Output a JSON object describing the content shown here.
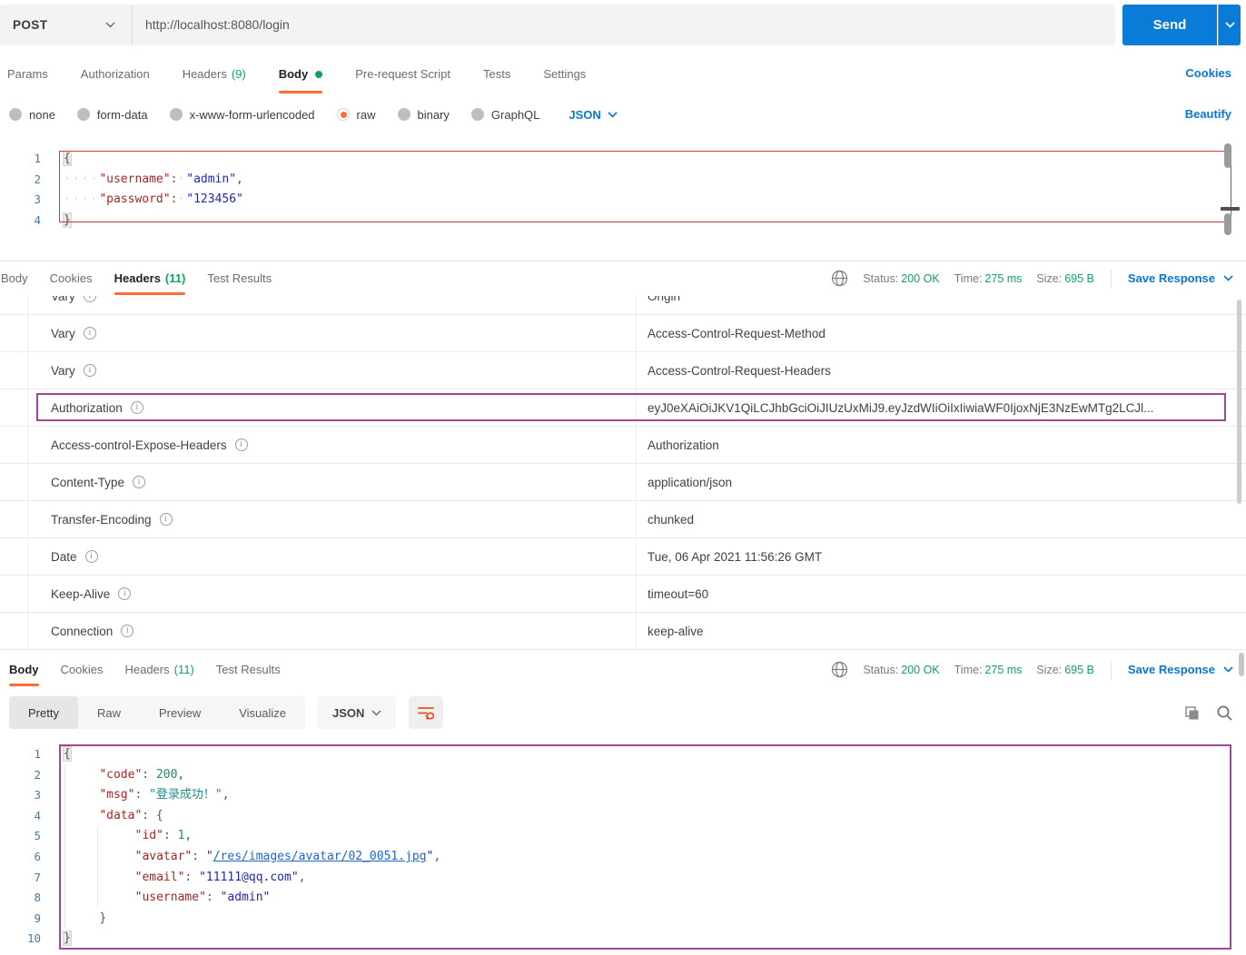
{
  "request": {
    "method": "POST",
    "url": "http://localhost:8080/login",
    "send_label": "Send",
    "cookies_link": "Cookies",
    "beautify_link": "Beautify",
    "raw_language": "JSON",
    "tabs": [
      {
        "label": "Params"
      },
      {
        "label": "Authorization"
      },
      {
        "label": "Headers",
        "count": "(9)"
      },
      {
        "label": "Body",
        "active": true,
        "dot": true
      },
      {
        "label": "Pre-request Script"
      },
      {
        "label": "Tests"
      },
      {
        "label": "Settings"
      }
    ],
    "body_modes": [
      {
        "label": "none"
      },
      {
        "label": "form-data"
      },
      {
        "label": "x-www-form-urlencoded"
      },
      {
        "label": "raw",
        "selected": true
      },
      {
        "label": "binary"
      },
      {
        "label": "GraphQL"
      }
    ],
    "body_lines": [
      {
        "n": "1",
        "tokens": [
          [
            "br",
            "{"
          ]
        ]
      },
      {
        "n": "2",
        "tokens": [
          [
            "ws",
            "····"
          ],
          [
            "key",
            "\"username\""
          ],
          [
            "pun",
            ":"
          ],
          [
            "ws",
            "·"
          ],
          [
            "str",
            "\"admin\""
          ],
          [
            "pun",
            ","
          ]
        ]
      },
      {
        "n": "3",
        "tokens": [
          [
            "ws",
            "····"
          ],
          [
            "key",
            "\"password\""
          ],
          [
            "pun",
            ":"
          ],
          [
            "ws",
            "·"
          ],
          [
            "str",
            "\"123456\""
          ]
        ]
      },
      {
        "n": "4",
        "tokens": [
          [
            "br",
            "}"
          ]
        ]
      }
    ]
  },
  "response_meta": {
    "status_label": "Status:",
    "status_value": "200 OK",
    "time_label": "Time:",
    "time_value": "275 ms",
    "size_label": "Size:",
    "size_value": "695 B",
    "save_label": "Save Response"
  },
  "headers_pane": {
    "tabs": [
      {
        "label": "Body"
      },
      {
        "label": "Cookies"
      },
      {
        "label": "Headers",
        "count": "(11)",
        "active": true
      },
      {
        "label": "Test Results"
      }
    ],
    "info_icon_glyph": "i",
    "rows": [
      {
        "key": "Vary",
        "value": "Origin"
      },
      {
        "key": "Vary",
        "value": "Access-Control-Request-Method"
      },
      {
        "key": "Vary",
        "value": "Access-Control-Request-Headers"
      },
      {
        "key": "Authorization",
        "value": "eyJ0eXAiOiJKV1QiLCJhbGciOiJIUzUxMiJ9.eyJzdWIiOiIxIiwiaWF0IjoxNjE3NzEwMTg2LCJl...",
        "highlighted": true
      },
      {
        "key": "Access-control-Expose-Headers",
        "value": "Authorization"
      },
      {
        "key": "Content-Type",
        "value": "application/json"
      },
      {
        "key": "Transfer-Encoding",
        "value": "chunked"
      },
      {
        "key": "Date",
        "value": "Tue, 06 Apr 2021 11:56:26 GMT"
      },
      {
        "key": "Keep-Alive",
        "value": "timeout=60"
      },
      {
        "key": "Connection",
        "value": "keep-alive"
      }
    ]
  },
  "body_pane": {
    "tabs": [
      {
        "label": "Body",
        "active": true
      },
      {
        "label": "Cookies"
      },
      {
        "label": "Headers",
        "count": "(11)"
      },
      {
        "label": "Test Results"
      }
    ],
    "views": [
      {
        "label": "Pretty",
        "selected": true
      },
      {
        "label": "Raw"
      },
      {
        "label": "Preview"
      },
      {
        "label": "Visualize"
      }
    ],
    "language": "JSON",
    "lines": [
      {
        "n": "1",
        "tokens": [
          [
            "br",
            "{"
          ]
        ]
      },
      {
        "n": "2",
        "tokens": [
          [
            "ws",
            "    "
          ],
          [
            "key",
            "\"code\""
          ],
          [
            "pun",
            ": "
          ],
          [
            "num",
            "200"
          ],
          [
            "pun",
            ","
          ]
        ]
      },
      {
        "n": "3",
        "tokens": [
          [
            "ws",
            "    "
          ],
          [
            "key",
            "\"msg\""
          ],
          [
            "pun",
            ": "
          ],
          [
            "cjk",
            "\"登录成功！\""
          ],
          [
            "pun",
            ","
          ]
        ]
      },
      {
        "n": "4",
        "tokens": [
          [
            "ws",
            "    "
          ],
          [
            "key",
            "\"data\""
          ],
          [
            "pun",
            ": {"
          ]
        ]
      },
      {
        "n": "5",
        "tokens": [
          [
            "ws",
            "        "
          ],
          [
            "key",
            "\"id\""
          ],
          [
            "pun",
            ": "
          ],
          [
            "num",
            "1"
          ],
          [
            "pun",
            ","
          ]
        ]
      },
      {
        "n": "6",
        "tokens": [
          [
            "ws",
            "        "
          ],
          [
            "key",
            "\"avatar\""
          ],
          [
            "pun",
            ": "
          ],
          [
            "str",
            "\""
          ],
          [
            "lnk",
            "/res/images/avatar/02_0051.jpg"
          ],
          [
            "str",
            "\""
          ],
          [
            "pun",
            ","
          ]
        ]
      },
      {
        "n": "7",
        "tokens": [
          [
            "ws",
            "        "
          ],
          [
            "key",
            "\"email\""
          ],
          [
            "pun",
            ": "
          ],
          [
            "str",
            "\"11111@qq.com\""
          ],
          [
            "pun",
            ","
          ]
        ]
      },
      {
        "n": "8",
        "tokens": [
          [
            "ws",
            "        "
          ],
          [
            "key",
            "\"username\""
          ],
          [
            "pun",
            ": "
          ],
          [
            "str",
            "\"admin\""
          ]
        ]
      },
      {
        "n": "9",
        "tokens": [
          [
            "ws",
            "    "
          ],
          [
            "pun",
            "}"
          ]
        ]
      },
      {
        "n": "10",
        "tokens": [
          [
            "br",
            "}"
          ]
        ]
      }
    ]
  },
  "colors": {
    "accent_orange": "#FF6C37",
    "link_blue": "#0B76D1",
    "success_green": "#12A35B",
    "send_button_blue": "#0A7BD6",
    "annotation_red": "#CE3B3B",
    "annotation_purple": "#9C4798",
    "code_key": "#A12727",
    "code_string": "#2127B4",
    "code_number": "#178F66"
  }
}
